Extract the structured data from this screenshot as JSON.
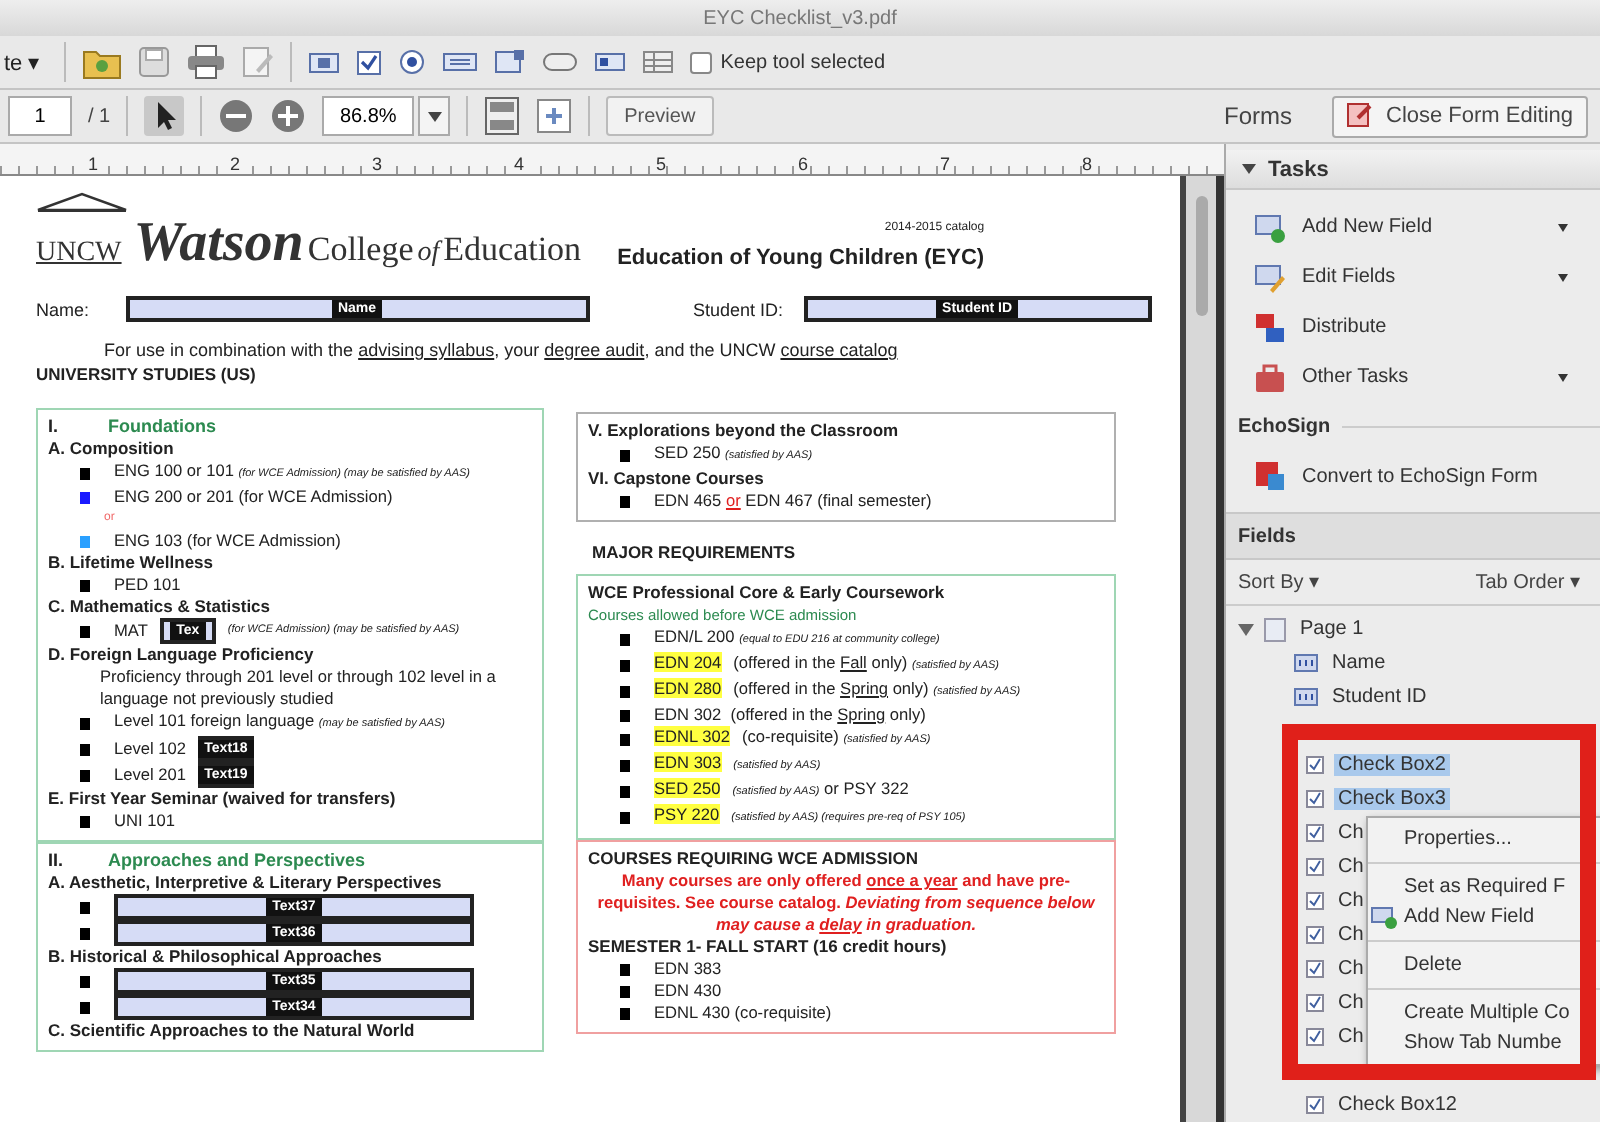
{
  "window": {
    "title": "EYC Checklist_v3.pdf"
  },
  "toolbar": {
    "create_menu": "te ▾",
    "keep_tool": {
      "label": "Keep tool selected",
      "checked": false
    }
  },
  "nav": {
    "page": "1",
    "page_count": "/ 1",
    "zoom": "86.8%",
    "preview": "Preview",
    "forms": "Forms",
    "close": "Close Form Editing"
  },
  "ruler": [
    "1",
    "2",
    "3",
    "4",
    "5",
    "6",
    "7",
    "8"
  ],
  "document": {
    "catalog": "2014-2015 catalog",
    "logo": {
      "mark": "UNCW",
      "script": "Watson",
      "college": "College",
      "of": "of",
      "education": "Education"
    },
    "program": "Education of Young Children (EYC)",
    "name_label": "Name:",
    "name_field": "Name",
    "id_label": "Student ID:",
    "id_field": "Student ID",
    "intro": [
      {
        "text": "For use in combination with the ",
        "kind": "plain"
      },
      {
        "text": "advising syllabus",
        "kind": "u"
      },
      {
        "text": ", your ",
        "kind": "plain"
      },
      {
        "text": "degree audit",
        "kind": "u"
      },
      {
        "text": ", and the UNCW ",
        "kind": "plain"
      },
      {
        "text": "course catalog",
        "kind": "u"
      }
    ],
    "studies": "UNIVERSITY STUDIES (US)",
    "columns": [
      [
        {
          "kind": "box",
          "color": "#9fd6b4",
          "items": [
            {
              "kind": "roman",
              "num": "I.",
              "text": "Foundations"
            },
            {
              "kind": "subhead",
              "text": "A. Composition"
            },
            {
              "kind": "course",
              "color": "#000000",
              "parts": [
                {
                  "text": "ENG 100 or 101 ",
                  "kind": "plain"
                },
                {
                  "text": "(for WCE Admission) (may be satisfied by AAS)",
                  "kind": "note"
                }
              ]
            },
            {
              "kind": "course",
              "color": "#1a1aff",
              "parts": [
                {
                  "text": "ENG 200 or 201 (for WCE Admission)",
                  "kind": "plain"
                }
              ]
            },
            {
              "kind": "or",
              "text": "or"
            },
            {
              "kind": "course",
              "color": "#2aa0ff",
              "parts": [
                {
                  "text": "ENG 103 (for WCE Admission)",
                  "kind": "plain"
                }
              ]
            },
            {
              "kind": "subhead",
              "text": "B. Lifetime Wellness"
            },
            {
              "kind": "course",
              "color": "#000000",
              "parts": [
                {
                  "text": "PED 101",
                  "kind": "plain"
                }
              ]
            },
            {
              "kind": "subhead",
              "text": "C. Mathematics & Statistics"
            },
            {
              "kind": "course",
              "color": "#000000",
              "parts": [
                {
                  "text": "MAT",
                  "kind": "plain"
                },
                {
                  "text": "Tex",
                  "kind": "field"
                },
                {
                  "text": "(for WCE Admission) (may be satisfied by AAS)",
                  "kind": "note"
                }
              ]
            },
            {
              "kind": "subhead",
              "text": "D. Foreign Language Proficiency"
            },
            {
              "kind": "para",
              "text": "Proficiency through 201 level or through 102 level in a language not previously studied"
            },
            {
              "kind": "course",
              "color": "#000000",
              "parts": [
                {
                  "text": "Level 101 foreign language ",
                  "kind": "plain"
                },
                {
                  "text": "(may be satisfied by AAS)",
                  "kind": "note"
                }
              ]
            },
            {
              "kind": "course",
              "color": "#000000",
              "parts": [
                {
                  "text": "Level 102",
                  "kind": "plain"
                },
                {
                  "text": "Text18",
                  "kind": "field"
                }
              ]
            },
            {
              "kind": "course",
              "color": "#000000",
              "parts": [
                {
                  "text": "Level 201",
                  "kind": "plain"
                },
                {
                  "text": "Text19",
                  "kind": "field"
                }
              ]
            },
            {
              "kind": "subhead",
              "text": "E. First Year Seminar (waived for transfers)"
            },
            {
              "kind": "course",
              "color": "#000000",
              "parts": [
                {
                  "text": "UNI 101",
                  "kind": "plain"
                }
              ]
            }
          ]
        },
        {
          "kind": "box",
          "color": "#9fd6b4",
          "items": [
            {
              "kind": "roman",
              "num": "II.",
              "text": "Approaches and Perspectives"
            },
            {
              "kind": "subhead",
              "text": "A. Aesthetic, Interpretive & Literary Perspectives"
            },
            {
              "kind": "field",
              "color": "#000000",
              "value": "Text37"
            },
            {
              "kind": "field",
              "color": "#000000",
              "value": "Text36"
            },
            {
              "kind": "subhead",
              "text": "B. Historical & Philosophical Approaches"
            },
            {
              "kind": "field",
              "color": "#000000",
              "value": "Text35"
            },
            {
              "kind": "field",
              "color": "#000000",
              "value": "Text34"
            },
            {
              "kind": "subhead",
              "text": "C. Scientific Approaches to the Natural World"
            }
          ]
        }
      ],
      [
        {
          "kind": "box",
          "color": "#b0b0b0",
          "items": [
            {
              "kind": "subhead",
              "text": "V. Explorations beyond the Classroom"
            },
            {
              "kind": "course",
              "color": "#000000",
              "parts": [
                {
                  "text": "SED 250 ",
                  "kind": "plain"
                },
                {
                  "text": "(satisfied by AAS)",
                  "kind": "note"
                }
              ]
            },
            {
              "kind": "subhead",
              "text": "VI. Capstone Courses"
            },
            {
              "kind": "course",
              "color": "#000000",
              "parts": [
                {
                  "text": "EDN 465 ",
                  "kind": "plain"
                },
                {
                  "text": "or",
                  "kind": "or"
                },
                {
                  "text": " EDN 467 (final semester)",
                  "kind": "plain"
                }
              ]
            }
          ]
        },
        {
          "kind": "heading",
          "text": "MAJOR REQUIREMENTS"
        },
        {
          "kind": "box",
          "color": "#9fd6b4",
          "items": [
            {
              "kind": "title",
              "text": "WCE Professional Core & Early Coursework"
            },
            {
              "kind": "caption",
              "text": "Courses allowed before WCE admission"
            },
            {
              "kind": "course",
              "color": "#000000",
              "parts": [
                {
                  "text": "EDN/L 200 ",
                  "kind": "plain"
                },
                {
                  "text": "(equal to EDU 216 at community college)",
                  "kind": "note"
                }
              ]
            },
            {
              "kind": "course",
              "color": "#000000",
              "parts": [
                {
                  "text": "EDN 204",
                  "kind": "hl"
                },
                {
                  "text": "(offered in the ",
                  "kind": "plain"
                },
                {
                  "text": "Fall",
                  "kind": "u"
                },
                {
                  "text": " only) ",
                  "kind": "plain"
                },
                {
                  "text": "(satisfied by AAS)",
                  "kind": "note"
                }
              ]
            },
            {
              "kind": "course",
              "color": "#000000",
              "parts": [
                {
                  "text": "EDN 280",
                  "kind": "hl"
                },
                {
                  "text": "(offered in the ",
                  "kind": "plain"
                },
                {
                  "text": "Spring",
                  "kind": "u"
                },
                {
                  "text": " only) ",
                  "kind": "plain"
                },
                {
                  "text": "(satisfied by AAS)",
                  "kind": "note"
                }
              ]
            },
            {
              "kind": "course",
              "color": "#000000",
              "parts": [
                {
                  "text": "EDN 302  (offered in the ",
                  "kind": "plain"
                },
                {
                  "text": "Spring",
                  "kind": "u"
                },
                {
                  "text": " only)",
                  "kind": "plain"
                }
              ]
            },
            {
              "kind": "course",
              "color": "#000000",
              "parts": [
                {
                  "text": "EDNL 302",
                  "kind": "hl"
                },
                {
                  "text": "(co-requisite) ",
                  "kind": "plain"
                },
                {
                  "text": "(satisfied by AAS)",
                  "kind": "note"
                }
              ]
            },
            {
              "kind": "course",
              "color": "#000000",
              "parts": [
                {
                  "text": "EDN 303",
                  "kind": "hl"
                },
                {
                  "text": "(satisfied by AAS)",
                  "kind": "note"
                }
              ]
            },
            {
              "kind": "course",
              "color": "#000000",
              "parts": [
                {
                  "text": "SED 250",
                  "kind": "hl"
                },
                {
                  "text": "(satisfied by AAS)",
                  "kind": "note"
                },
                {
                  "text": " or PSY 322",
                  "kind": "plain"
                }
              ]
            },
            {
              "kind": "course",
              "color": "#000000",
              "parts": [
                {
                  "text": "PSY 220",
                  "kind": "hl"
                },
                {
                  "text": "(satisfied by AAS) (requires pre-req of PSY 105)",
                  "kind": "note"
                }
              ]
            }
          ]
        },
        {
          "kind": "box",
          "color": "#f0a0a0",
          "items": [
            {
              "kind": "title",
              "text": "COURSES REQUIRING WCE ADMISSION"
            },
            {
              "kind": "warning",
              "parts": [
                {
                  "text": "Many courses are only offered ",
                  "kind": "warn"
                },
                {
                  "text": "once a year",
                  "kind": "warn_u"
                },
                {
                  "text": " and have pre-requisites. See course catalog. ",
                  "kind": "warn"
                },
                {
                  "text": "Deviating from sequence below may cause a ",
                  "kind": "warn_i"
                },
                {
                  "text": "delay",
                  "kind": "warn_iu"
                },
                {
                  "text": " in graduation.",
                  "kind": "warn_i"
                }
              ]
            },
            {
              "kind": "title",
              "text": "SEMESTER 1- FALL START (16 credit hours)"
            },
            {
              "kind": "course",
              "color": "#000000",
              "parts": [
                {
                  "text": "EDN 383",
                  "kind": "plain"
                }
              ]
            },
            {
              "kind": "course",
              "color": "#000000",
              "parts": [
                {
                  "text": "EDN 430",
                  "kind": "plain"
                }
              ]
            },
            {
              "kind": "course",
              "color": "#000000",
              "parts": [
                {
                  "text": "EDNL 430 (co-requisite)",
                  "kind": "plain"
                }
              ]
            }
          ]
        }
      ]
    ]
  },
  "tasks": {
    "title": "Tasks",
    "items": [
      {
        "label": "Add New Field",
        "menu": true
      },
      {
        "label": "Edit Fields",
        "menu": true
      },
      {
        "label": "Distribute",
        "menu": false
      },
      {
        "label": "Other Tasks",
        "menu": true
      }
    ]
  },
  "echosign": {
    "title": "EchoSign",
    "items": [
      {
        "label": "Convert to EchoSign Form"
      }
    ]
  },
  "fields": {
    "title": "Fields",
    "sort": "Sort By ▾",
    "order": "Tab Order ▾",
    "tree": [
      {
        "label": "Page 1",
        "expanded": true,
        "children": [
          {
            "label": "Name",
            "kind": "text",
            "selected": false
          },
          {
            "label": "Student ID",
            "kind": "text",
            "selected": false
          },
          {
            "label": "Check Box2",
            "kind": "checkbox",
            "selected": true
          },
          {
            "label": "Check Box3",
            "kind": "checkbox",
            "selected": true
          },
          {
            "label": "Ch",
            "kind": "checkbox",
            "selected": false
          },
          {
            "label": "Ch",
            "kind": "checkbox",
            "selected": false
          },
          {
            "label": "Ch",
            "kind": "checkbox",
            "selected": false
          },
          {
            "label": "Ch",
            "kind": "checkbox",
            "selected": false
          },
          {
            "label": "Ch",
            "kind": "checkbox",
            "selected": false
          },
          {
            "label": "Ch",
            "kind": "checkbox",
            "selected": false
          },
          {
            "label": "Ch",
            "kind": "checkbox",
            "selected": false
          },
          {
            "label": "Check Box12",
            "kind": "checkbox",
            "selected": false
          }
        ]
      }
    ]
  },
  "context_menu": {
    "items": [
      {
        "kind": "item",
        "label": "Properties...",
        "icon": false
      },
      {
        "kind": "separator"
      },
      {
        "kind": "item",
        "label": "Set as Required F",
        "icon": false
      },
      {
        "kind": "item",
        "label": "Add New Field",
        "icon": true
      },
      {
        "kind": "separator"
      },
      {
        "kind": "item",
        "label": "Delete",
        "icon": false
      },
      {
        "kind": "separator"
      },
      {
        "kind": "item",
        "label": "Create Multiple Co",
        "icon": false
      },
      {
        "kind": "item",
        "label": "Show Tab Numbe",
        "icon": false
      }
    ]
  }
}
